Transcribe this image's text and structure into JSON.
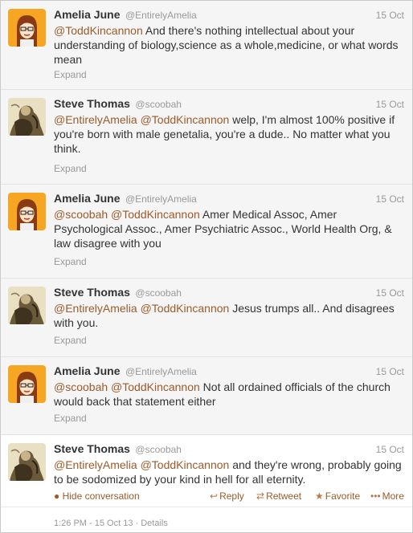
{
  "colors": {
    "link": "#9b5b2b",
    "muted": "#999999",
    "text": "#333333",
    "amelia_avatar_bg": "#f6a623"
  },
  "tweets": [
    {
      "author": "Amelia June",
      "handle": "@EntirelyAmelia",
      "date": "15 Oct",
      "avatar": "amelia-avatar",
      "mentions": [
        "@ToddKincannon"
      ],
      "body": " And there's nothing intellectual about your understanding of biology,science as a whole,medicine, or what words mean",
      "expand": "Expand"
    },
    {
      "author": "Steve Thomas",
      "handle": "@scoobah",
      "date": "15 Oct",
      "avatar": "steve-avatar",
      "mentions": [
        "@EntirelyAmelia",
        "@ToddKincannon"
      ],
      "body": " welp, I'm almost 100% positive if you're born with male genetalia, you're a dude.. No matter what you think.",
      "expand": "Expand"
    },
    {
      "author": "Amelia June",
      "handle": "@EntirelyAmelia",
      "date": "15 Oct",
      "avatar": "amelia-avatar",
      "mentions": [
        "@scoobah",
        "@ToddKincannon"
      ],
      "body": " Amer Medical Assoc, Amer Psychological Assoc., Amer Psychiatric Assoc., World Health Org, & law disagree with you",
      "expand": "Expand"
    },
    {
      "author": "Steve Thomas",
      "handle": "@scoobah",
      "date": "15 Oct",
      "avatar": "steve-avatar",
      "mentions": [
        "@EntirelyAmelia",
        "@ToddKincannon"
      ],
      "body": " Jesus trumps all.. And disagrees with you.",
      "expand": "Expand"
    },
    {
      "author": "Amelia June",
      "handle": "@EntirelyAmelia",
      "date": "15 Oct",
      "avatar": "amelia-avatar",
      "mentions": [
        "@scoobah",
        "@ToddKincannon"
      ],
      "body": " Not all ordained officials of the church would back that statement either",
      "expand": "Expand"
    },
    {
      "author": "Steve Thomas",
      "handle": "@scoobah",
      "date": "15 Oct",
      "avatar": "steve-avatar",
      "mentions": [
        "@EntirelyAmelia",
        "@ToddKincannon"
      ],
      "body": " and they're wrong, probably going to be sodomized by your kind in hell for all eternity."
    }
  ],
  "expanded_tweet": {
    "hide_conversation": "Hide conversation",
    "actions": {
      "reply": "Reply",
      "retweet": "Retweet",
      "favorite": "Favorite",
      "more": "More"
    },
    "timestamp": "1:26 PM - 15 Oct 13",
    "separator": "·",
    "details": "Details"
  }
}
